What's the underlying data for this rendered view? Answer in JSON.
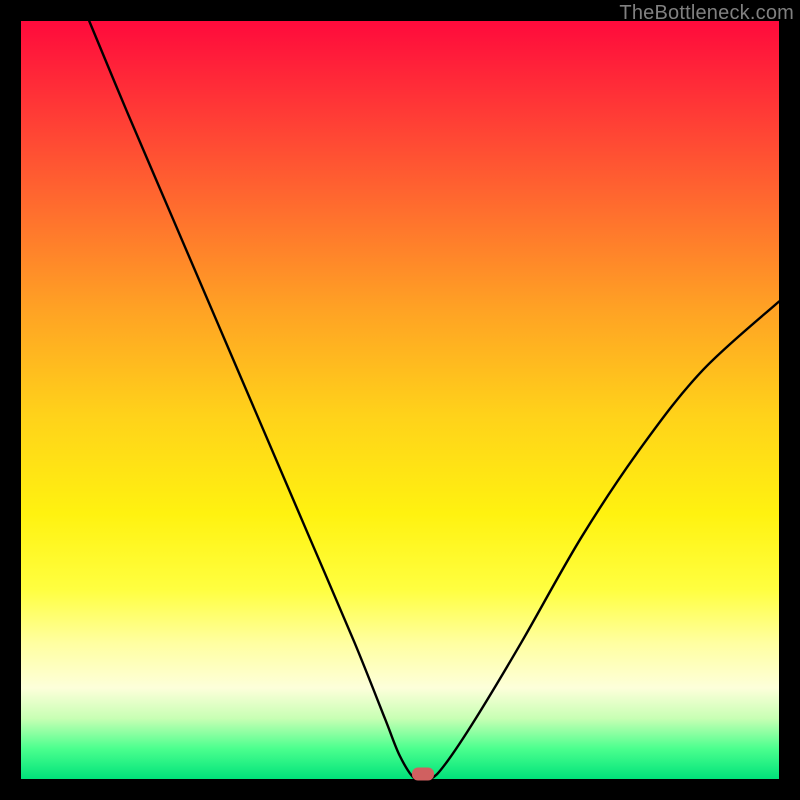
{
  "attribution": "TheBottleneck.com",
  "chart_data": {
    "type": "line",
    "title": "",
    "xlabel": "",
    "ylabel": "",
    "xlim": [
      0,
      100
    ],
    "ylim": [
      0,
      100
    ],
    "series": [
      {
        "name": "bottleneck-curve",
        "x": [
          9,
          14,
          20,
          26,
          32,
          38,
          44,
          48,
          50,
          52,
          54,
          56,
          60,
          66,
          74,
          82,
          90,
          100
        ],
        "values": [
          100,
          88,
          74,
          60,
          46,
          32,
          18,
          8,
          3,
          0,
          0,
          2,
          8,
          18,
          32,
          44,
          54,
          63
        ]
      }
    ],
    "marker": {
      "x": 53,
      "y": 0.7,
      "color": "#d06060"
    }
  }
}
